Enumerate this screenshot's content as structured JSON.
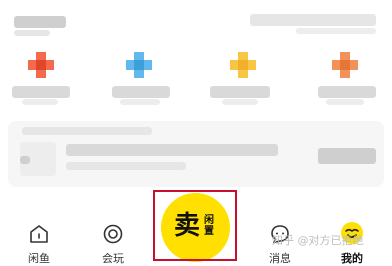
{
  "tabs": [
    {
      "id": "home",
      "label": "闲鱼",
      "icon": "home-icon",
      "active": false
    },
    {
      "id": "play",
      "label": "会玩",
      "icon": "circle-icon",
      "active": false
    },
    {
      "id": "messages",
      "label": "消息",
      "icon": "chat-icon",
      "active": false
    },
    {
      "id": "mine",
      "label": "我的",
      "icon": "avatar-icon",
      "active": true
    }
  ],
  "sell_button": {
    "main": "卖",
    "sub": "闲置"
  },
  "watermark": "知乎 @对方已拒绝",
  "colors": {
    "accent": "#ffe000",
    "highlight_border": "#c8102e",
    "tile_red": "#f26b4a",
    "tile_blue": "#62b8ec",
    "tile_yellow": "#f8c544",
    "tile_orange": "#f2915a"
  }
}
